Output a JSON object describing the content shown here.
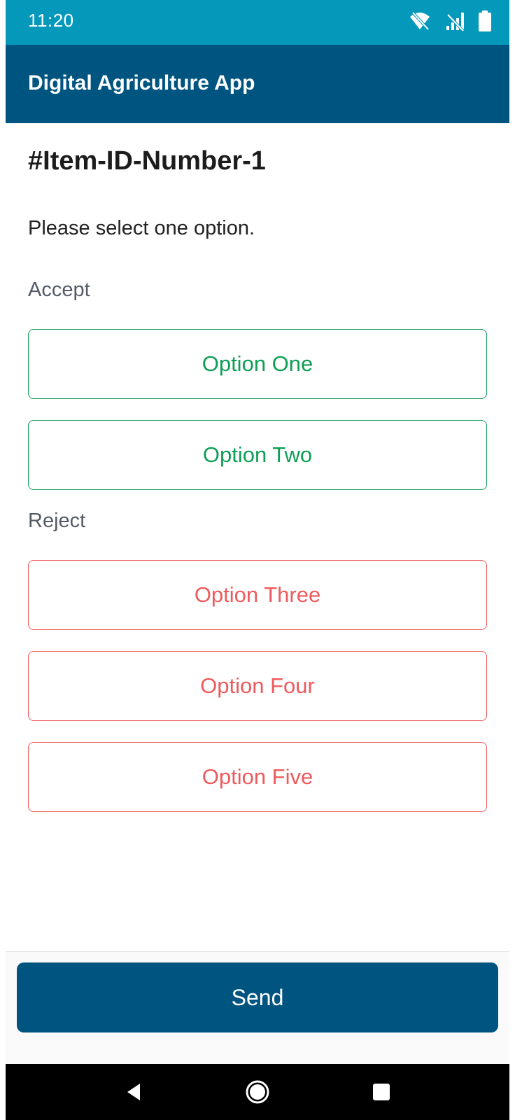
{
  "status_bar": {
    "time": "11:20",
    "icons": [
      "wifi-off-icon",
      "signal-off-icon",
      "battery-icon"
    ],
    "background_color": "#0498bb"
  },
  "app_bar": {
    "title": "Digital Agriculture App",
    "background_color": "#005480"
  },
  "page": {
    "item_id": "#Item-ID-Number-1",
    "prompt": "Please select one option."
  },
  "accept": {
    "label": "Accept",
    "color": "#0e9e55",
    "options": [
      "Option One",
      "Option Two"
    ]
  },
  "reject": {
    "label": "Reject",
    "color": "#ee5a5d",
    "options": [
      "Option Three",
      "Option Four",
      "Option Five"
    ]
  },
  "footer": {
    "send_label": "Send",
    "send_color": "#005480"
  },
  "nav_bar": {
    "icons": [
      "back-icon",
      "home-icon",
      "recents-icon"
    ]
  }
}
